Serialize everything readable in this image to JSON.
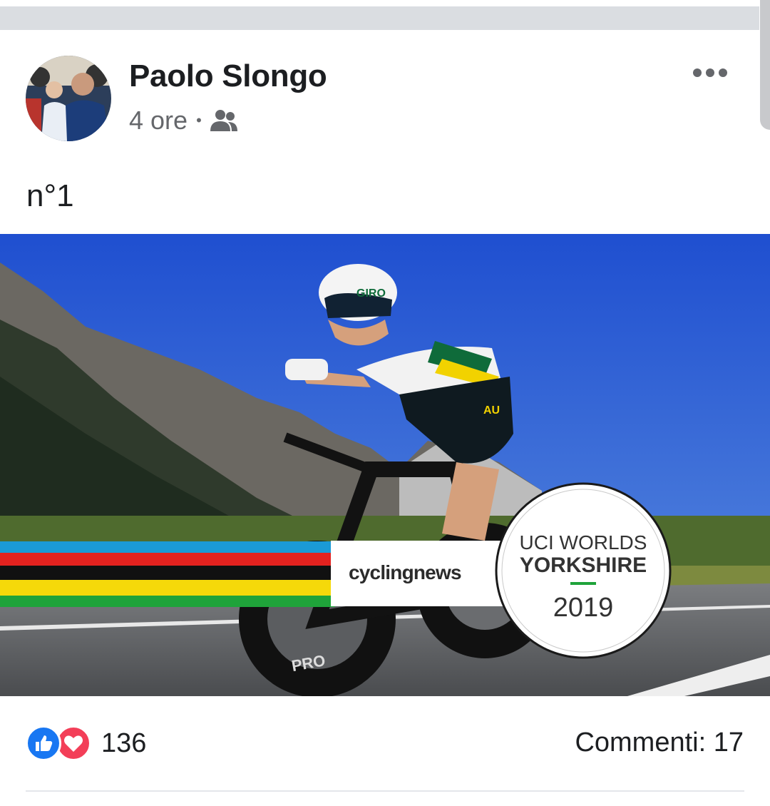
{
  "post": {
    "author": "Paolo Slongo",
    "time": "4 ore",
    "separator": "•",
    "audience_icon": "friends-icon",
    "more_icon": "more-options-icon",
    "text": "n°1"
  },
  "photo": {
    "logo_text": "cyclingnews",
    "badge_line1": "UCI WORLDS",
    "badge_line2": "YORKSHIRE",
    "badge_year": "2019",
    "jersey_letters": "AU",
    "helmet_text": "GIRO",
    "bike_brand": "PRO",
    "rainbow_colors": [
      "#1b9ad6",
      "#e3221f",
      "#111111",
      "#f5d90a",
      "#1fa33a"
    ]
  },
  "reactions": {
    "icons": [
      "like-icon",
      "love-icon"
    ],
    "count": "136"
  },
  "comments_label": "Commenti: 17",
  "colors": {
    "like_blue": "#1877f2",
    "love_red": "#f33e58",
    "meta_gray": "#65676b"
  }
}
